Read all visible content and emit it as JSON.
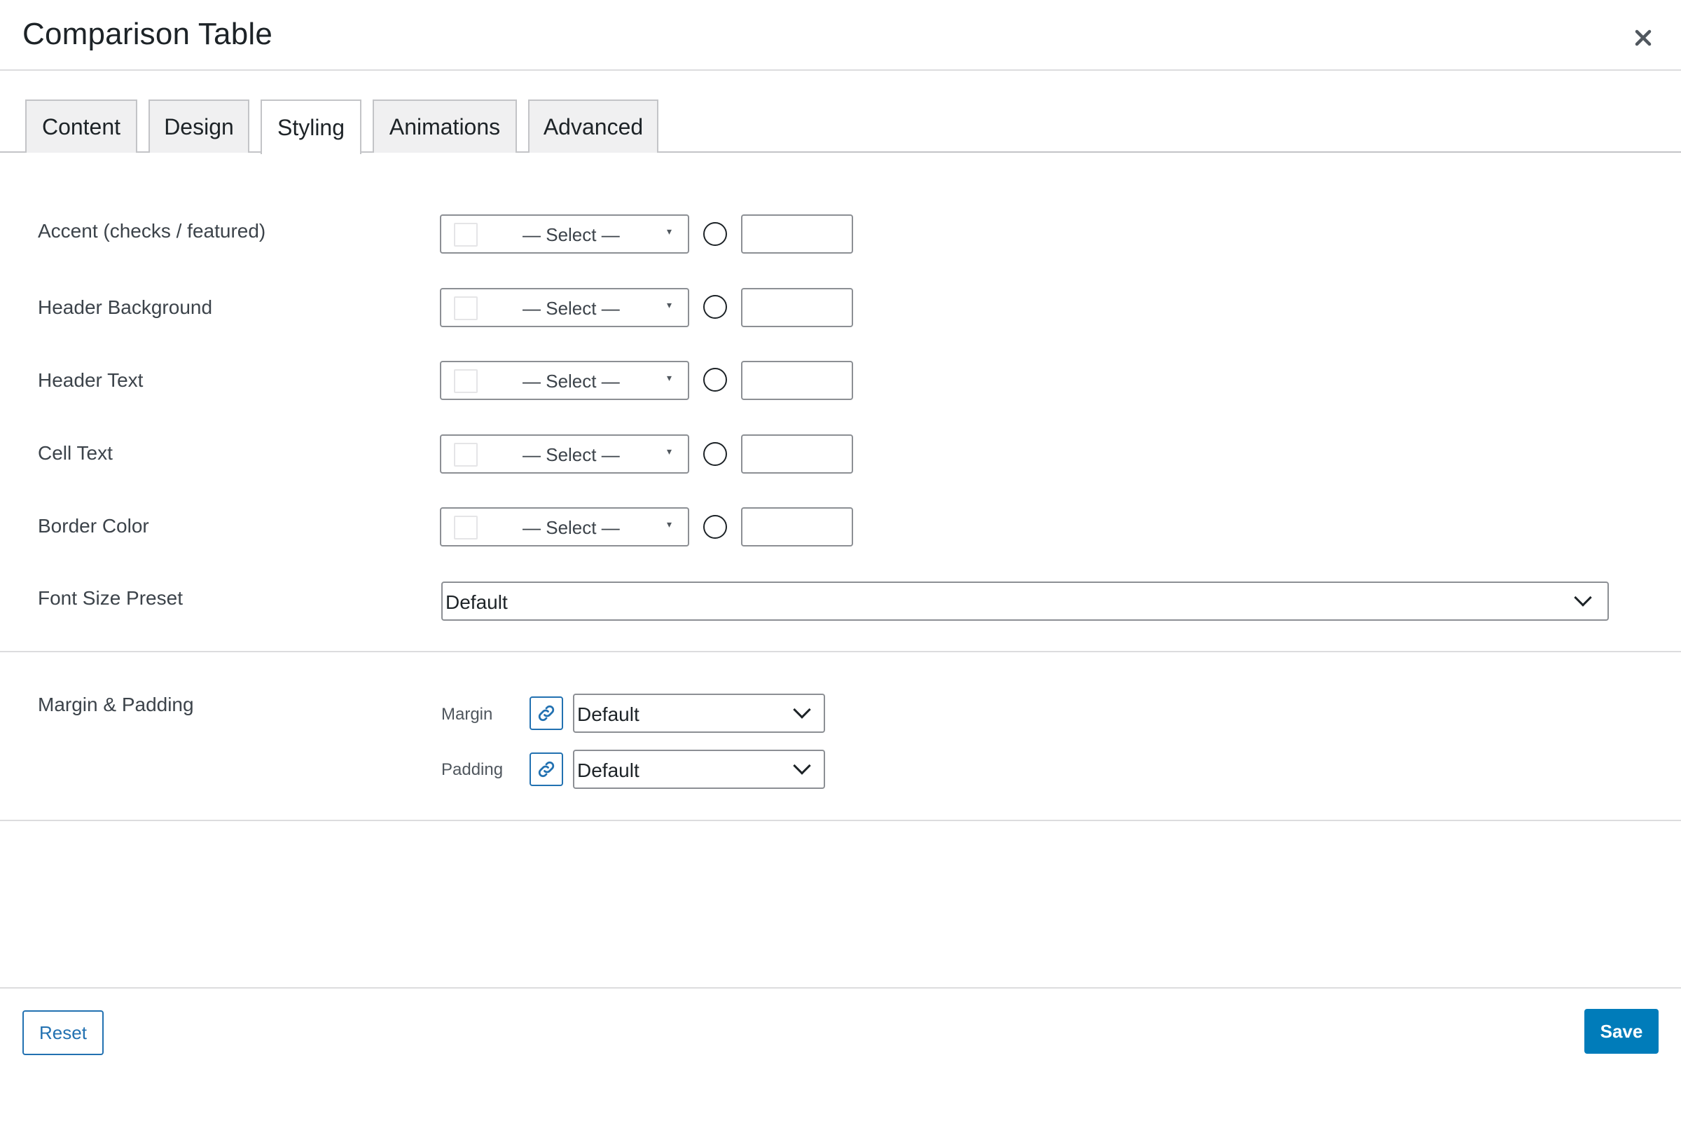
{
  "modal": {
    "title": "Comparison Table",
    "close_icon": "close-icon"
  },
  "tabs": [
    {
      "label": "Content",
      "active": false
    },
    {
      "label": "Design",
      "active": false
    },
    {
      "label": "Styling",
      "active": true
    },
    {
      "label": "Animations",
      "active": false
    },
    {
      "label": "Advanced",
      "active": false
    }
  ],
  "color_fields": [
    {
      "label": "Accent (checks / featured)",
      "select_text": "— Select —",
      "hex_value": ""
    },
    {
      "label": "Header Background",
      "select_text": "— Select —",
      "hex_value": ""
    },
    {
      "label": "Header Text",
      "select_text": "— Select —",
      "hex_value": ""
    },
    {
      "label": "Cell Text",
      "select_text": "— Select —",
      "hex_value": ""
    },
    {
      "label": "Border Color",
      "select_text": "— Select —",
      "hex_value": ""
    }
  ],
  "font_size_preset": {
    "label": "Font Size Preset",
    "value": "Default"
  },
  "margin_padding": {
    "label": "Margin & Padding",
    "margin": {
      "label": "Margin",
      "value": "Default",
      "icon": "link-icon"
    },
    "padding": {
      "label": "Padding",
      "value": "Default",
      "icon": "link-icon"
    }
  },
  "footer": {
    "reset_label": "Reset",
    "save_label": "Save"
  },
  "colors": {
    "primary": "#2271b1",
    "save_bg": "#007cba",
    "border": "#8c8f94",
    "divider": "#dcdcde"
  }
}
